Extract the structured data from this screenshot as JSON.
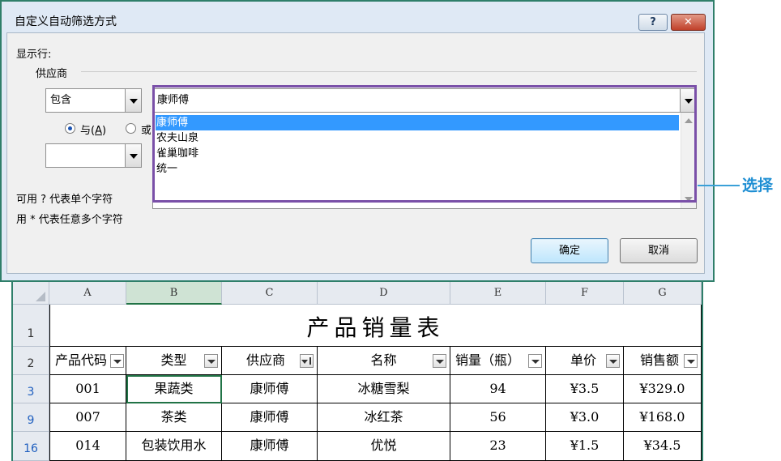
{
  "dialog": {
    "title": "自定义自动筛选方式",
    "help_label": "?",
    "close_label": "✕",
    "show_rows_label": "显示行:",
    "field_label": "供应商",
    "operator1": "包含",
    "value1": "康师傅",
    "radio_and": "与(A)",
    "radio_or": "或",
    "operator2": "",
    "dropdown_items": [
      "康师傅",
      "农夫山泉",
      "雀巢咖啡",
      "统一"
    ],
    "hint1": "可用 ? 代表单个字符",
    "hint2": "用 * 代表任意多个字符",
    "ok_label": "确定",
    "cancel_label": "取消"
  },
  "annotation": {
    "label": "选择",
    "color": "#7a50a8"
  },
  "sheet": {
    "columns": [
      "A",
      "B",
      "C",
      "D",
      "E",
      "F",
      "G"
    ],
    "title": "产品销量表",
    "headers": [
      "产品代码",
      "类型",
      "供应商",
      "名称",
      "销量（瓶）",
      "单价",
      "销售额"
    ],
    "row_numbers": [
      "1",
      "2",
      "3",
      "9",
      "16"
    ],
    "rows": [
      [
        "001",
        "果蔬类",
        "康师傅",
        "冰糖雪梨",
        "94",
        "¥3.5",
        "¥329.0"
      ],
      [
        "007",
        "茶类",
        "康师傅",
        "冰红茶",
        "56",
        "¥3.0",
        "¥168.0"
      ],
      [
        "014",
        "包装饮用水",
        "康师傅",
        "优悦",
        "23",
        "¥1.5",
        "¥34.5"
      ]
    ]
  }
}
